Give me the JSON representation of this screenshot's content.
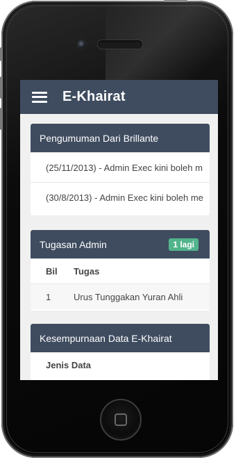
{
  "app": {
    "title": "E-Khairat"
  },
  "announcements": {
    "title": "Pengumuman Dari Brillante",
    "items": [
      "(25/11/2013) - Admin Exec kini boleh m",
      "(30/8/2013) - Admin Exec kini boleh me"
    ]
  },
  "tasks": {
    "title": "Tugasan Admin",
    "badge": "1 lagi",
    "columns": [
      "Bil",
      "Tugas"
    ],
    "rows": [
      {
        "bil": "1",
        "tugas": "Urus Tunggakan Yuran Ahli"
      }
    ]
  },
  "completeness": {
    "title": "Kesempurnaan Data E-Khairat",
    "columns": [
      "Jenis Data"
    ]
  }
}
